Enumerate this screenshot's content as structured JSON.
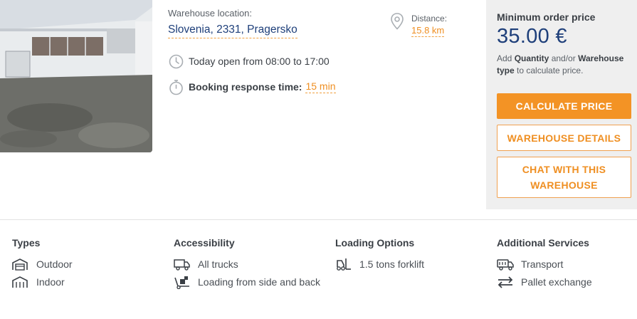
{
  "location": {
    "label": "Warehouse location:",
    "value": "Slovenia, 2331, Pragersko",
    "distance_label": "Distance:",
    "distance_value": "15.8 km"
  },
  "hours": {
    "text": "Today open from 08:00 to 17:00"
  },
  "response": {
    "label": "Booking response time:",
    "value": "15 min"
  },
  "panel": {
    "title": "Minimum order price",
    "price": "35.00 €",
    "note_pre": "Add ",
    "note_b1": "Quantity",
    "note_mid": " and/or ",
    "note_b2": "Warehouse type",
    "note_post": " to calculate price.",
    "calc_button": "CALCULATE PRICE",
    "details_button": "WAREHOUSE DETAILS",
    "chat_button": "CHAT WITH THIS WAREHOUSE"
  },
  "features": {
    "types": {
      "title": "Types",
      "items": [
        "Outdoor",
        "Indoor"
      ]
    },
    "accessibility": {
      "title": "Accessibility",
      "items": [
        "All trucks",
        "Loading from side and back"
      ]
    },
    "loading": {
      "title": "Loading Options",
      "items": [
        "1.5 tons forklift"
      ]
    },
    "services": {
      "title": "Additional Services",
      "items": [
        "Transport",
        "Pallet exchange"
      ]
    }
  },
  "colors": {
    "accent": "#f39325",
    "brand": "#1e3f7a",
    "panel_bg": "#efefef"
  }
}
